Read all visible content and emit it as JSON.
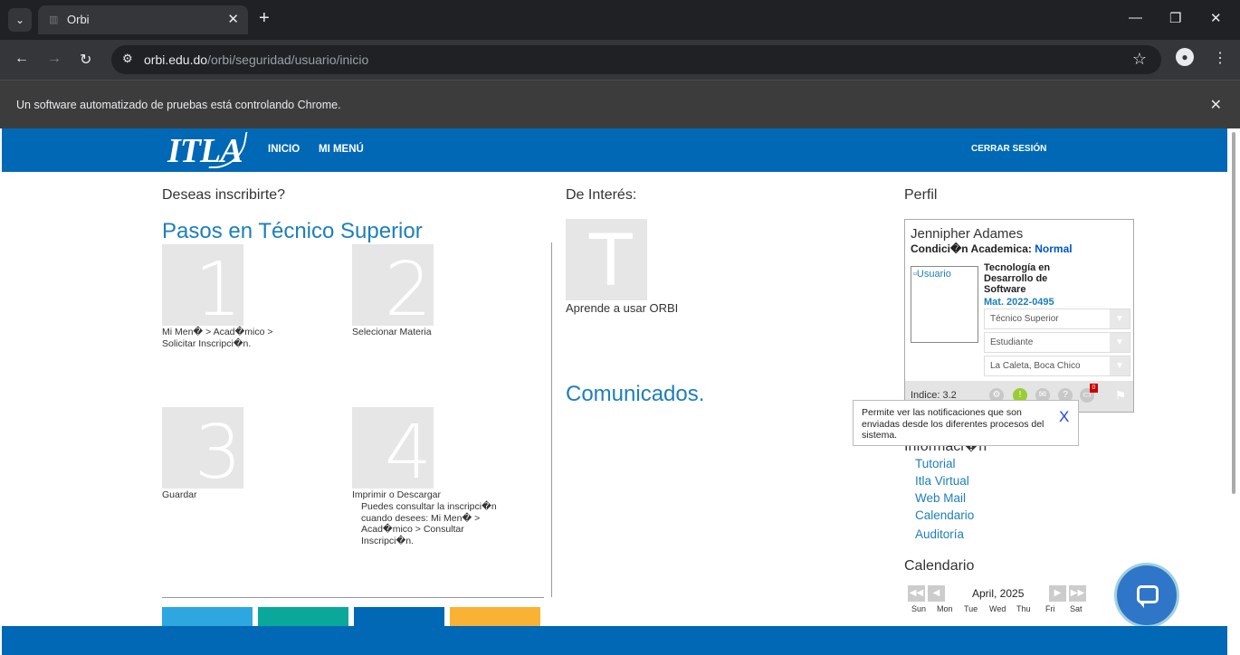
{
  "browser": {
    "tab_title": "Orbi",
    "url_host": "orbi.edu.do",
    "url_path": "/orbi/seguridad/usuario/inicio",
    "infobar": "Un software automatizado de pruebas está controlando Chrome."
  },
  "header": {
    "logo": "ITLA",
    "nav": [
      "INICIO",
      "MI MENÚ"
    ],
    "logout": "CERRAR SESIÓN"
  },
  "left": {
    "heading": "Deseas inscribirte?",
    "title_a": "Pasos en",
    "title_b": "Técnico Superior",
    "steps": [
      {
        "num": "1",
        "text": "Mi Men� > Acad�mico > Solicitar Inscripci�n."
      },
      {
        "num": "2",
        "text": "Selecionar Materia"
      },
      {
        "num": "3",
        "text": "Guardar"
      },
      {
        "num": "4",
        "text": "Imprimir o Descargar",
        "sub": "Puedes consultar la inscripci�n cuando desees: Mi Men� > Acad�mico > Consultar Inscripci�n."
      }
    ],
    "tile_colors": [
      "#2ea7e0",
      "#0aa89a",
      "#0068b4",
      "#f9b233"
    ]
  },
  "middle": {
    "heading": "De Interés:",
    "tile_letter": "T",
    "tile_caption": "Aprende a usar ORBI",
    "comunicados": "Comunicados."
  },
  "profile": {
    "heading": "Perfil",
    "name": "Jennipher Adames",
    "cond_label": "Condici�n Academica:",
    "cond_value": "Normal",
    "photo_alt": "Usuario",
    "career": "Tecnología en Desarrollo de Software",
    "mat": "Mat. 2022-0495",
    "selects": [
      "Técnico Superior",
      "Estudiante",
      "La Caleta, Boca Chico"
    ],
    "indice": "Indice: 3.2",
    "badge": "0"
  },
  "tooltip": {
    "text": "Permite ver las notificaciones que son enviadas desde los diferentes procesos del sistema.",
    "close": "X"
  },
  "info": {
    "heading": "Informaci�n",
    "links": [
      "Tutorial",
      "Itla Virtual",
      "Web Mail",
      "Calendario",
      "Auditoría"
    ]
  },
  "calendar": {
    "heading": "Calendario",
    "month": "April, 2025",
    "days": [
      "Sun",
      "Mon",
      "Tue",
      "Wed",
      "Thu",
      "Fri",
      "Sat"
    ]
  }
}
